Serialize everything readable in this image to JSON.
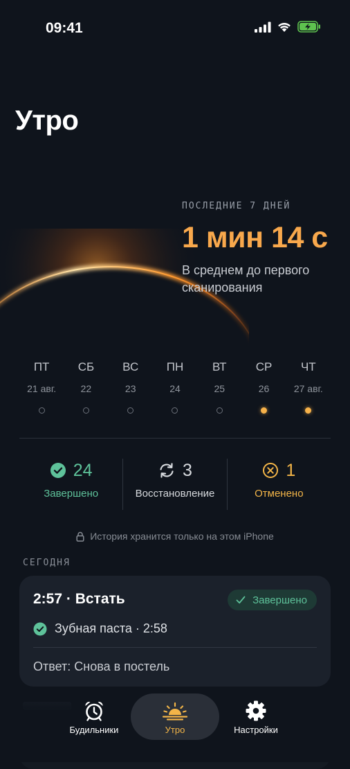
{
  "status_bar": {
    "time": "09:41"
  },
  "page_title": "Утро",
  "stats": {
    "caption": "ПОСЛЕДНИЕ 7 ДНЕЙ",
    "value": "1 мин 14 с",
    "description": "В среднем до первого сканирования"
  },
  "week": [
    {
      "name": "ПТ",
      "date": "21 авг.",
      "done": false
    },
    {
      "name": "СБ",
      "date": "22",
      "done": false
    },
    {
      "name": "ВС",
      "date": "23",
      "done": false
    },
    {
      "name": "ПН",
      "date": "24",
      "done": false
    },
    {
      "name": "ВТ",
      "date": "25",
      "done": false
    },
    {
      "name": "СР",
      "date": "26",
      "done": true
    },
    {
      "name": "ЧТ",
      "date": "27 авг.",
      "done": true
    }
  ],
  "counters": {
    "completed": {
      "value": "24",
      "label": "Завершено",
      "color": "#5ec29a"
    },
    "recovery": {
      "value": "3",
      "label": "Восстановление",
      "color": "#d7dade"
    },
    "cancelled": {
      "value": "1",
      "label": "Отменено",
      "color": "#f3b548"
    }
  },
  "privacy_note": "История хранится только на этом iPhone",
  "today": {
    "section_label": "СЕГОДНЯ",
    "card": {
      "title": "2:57 · Встать",
      "status": "Завершено",
      "task": "Зубная паста · 2:58",
      "answer": "Ответ: Снова в постель"
    }
  },
  "tabs": {
    "alarms": {
      "label": "Будильники",
      "icon": "alarm-clock-icon"
    },
    "morning": {
      "label": "Утро",
      "icon": "sunrise-icon",
      "active": true
    },
    "settings": {
      "label": "Настройки",
      "icon": "gear-icon"
    }
  },
  "colors": {
    "accent": "#f3b548",
    "success": "#5ec29a",
    "background": "#0f141c"
  }
}
